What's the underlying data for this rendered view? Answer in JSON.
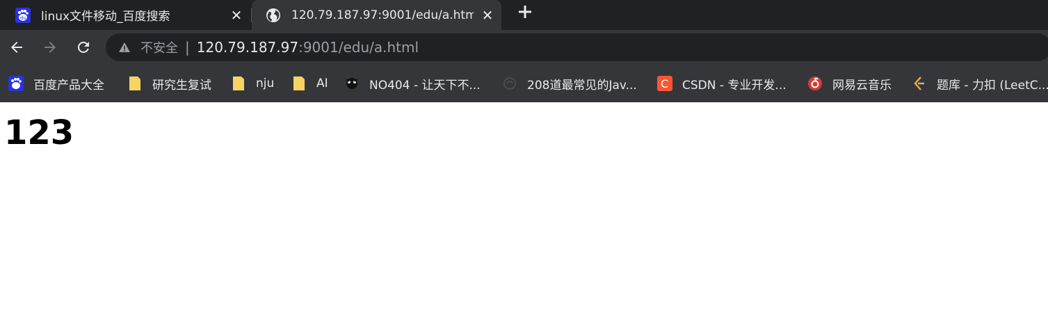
{
  "tabs": [
    {
      "title": "linux文件移动_百度搜索",
      "favicon": "baidu-icon",
      "active": false
    },
    {
      "title": "120.79.187.97:9001/edu/a.htm",
      "favicon": "globe-icon",
      "active": true
    }
  ],
  "toolbar": {
    "security_label": "不安全",
    "divider": "|",
    "url_host": "120.79.187.97",
    "url_path": ":9001/edu/a.html"
  },
  "bookmarks": [
    {
      "label": "百度产品大全",
      "icon": "baidu-icon"
    },
    {
      "label": "研究生复试",
      "icon": "folder-icon"
    },
    {
      "label": "nju",
      "icon": "folder-icon"
    },
    {
      "label": "AI",
      "icon": "folder-icon"
    },
    {
      "label": "NO404 - 让天下不...",
      "icon": "no404-icon"
    },
    {
      "label": "208道最常见的Jav...",
      "icon": "java-icon"
    },
    {
      "label": "CSDN - 专业开发...",
      "icon": "csdn-icon"
    },
    {
      "label": "网易云音乐",
      "icon": "netease-music-icon"
    },
    {
      "label": "题库 - 力扣 (LeetC...",
      "icon": "leetcode-icon"
    }
  ],
  "page": {
    "heading": "123"
  },
  "colors": {
    "tabstrip_bg": "#202124",
    "toolbar_bg": "#35363a",
    "omnibox_bg": "#202124",
    "text": "#e8eaed",
    "muted_text": "#9aa0a6",
    "baidu_blue": "#2932e1",
    "folder_yellow": "#f6d365",
    "csdn_red": "#fc5531",
    "netease_red": "#d43c33"
  }
}
